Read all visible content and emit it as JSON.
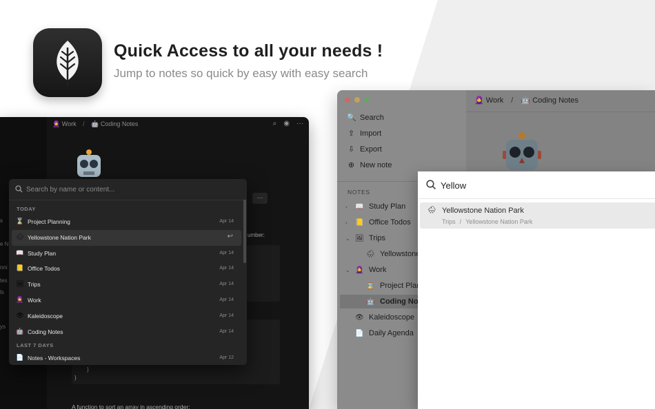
{
  "header": {
    "title": "Quick Access to all your needs !",
    "subtitle": "Jump to notes so quick by easy with easy search"
  },
  "dark_window": {
    "breadcrumb": [
      {
        "icon": "🧕",
        "label": "Work"
      },
      {
        "icon": "🤖",
        "label": "Coding Notes"
      }
    ],
    "fragments": {
      "number_text": "umber:",
      "brace1": "}",
      "brace2": "}",
      "bottom_text": "A function to sort an array in ascending order:",
      "ellipsis": "···"
    },
    "sidebar_edge": [
      "s",
      "e N",
      "nni",
      "tes",
      "ls",
      "ys"
    ],
    "search": {
      "placeholder": "Search by name or content...",
      "sections": [
        {
          "label": "TODAY",
          "items": [
            {
              "icon": "⌛",
              "name": "Project Planning",
              "date": "Apr 14"
            },
            {
              "icon": "🌧",
              "name": "Yellowstone Nation Park",
              "date": "",
              "selected": true
            },
            {
              "icon": "📖",
              "name": "Study Plan",
              "date": "Apr 14"
            },
            {
              "icon": "📒",
              "name": "Office Todos",
              "date": "Apr 14"
            },
            {
              "icon": "🖼",
              "name": "Trips",
              "date": "Apr 14"
            },
            {
              "icon": "🧕",
              "name": "Work",
              "date": "Apr 14"
            },
            {
              "icon": "👁",
              "name": "Kaleidoscope",
              "date": "Apr 14"
            },
            {
              "icon": "🤖",
              "name": "Coding Notes",
              "date": "Apr 14"
            }
          ]
        },
        {
          "label": "LAST 7 DAYS",
          "items": [
            {
              "icon": "📄",
              "name": "Notes - Workspaces",
              "date": "Apr 12"
            }
          ]
        }
      ]
    }
  },
  "light_window": {
    "menu": [
      {
        "icon": "🔍",
        "label": "Search"
      },
      {
        "icon": "⇪",
        "label": "Import"
      },
      {
        "icon": "⇩",
        "label": "Export"
      },
      {
        "icon": "⊕",
        "label": "New note"
      }
    ],
    "notes_label": "NOTES",
    "tree": [
      {
        "chevron": "›",
        "icon": "📖",
        "label": "Study Plan",
        "indent": 0
      },
      {
        "chevron": "›",
        "icon": "📒",
        "label": "Office Todos",
        "indent": 0
      },
      {
        "chevron": "⌄",
        "icon": "🖼",
        "label": "Trips",
        "indent": 0
      },
      {
        "chevron": "",
        "icon": "🌧",
        "label": "Yellowstone N",
        "indent": 1
      },
      {
        "chevron": "⌄",
        "icon": "🧕",
        "label": "Work",
        "indent": 0
      },
      {
        "chevron": "",
        "icon": "⌛",
        "label": "Project Planni",
        "indent": 1
      },
      {
        "chevron": "",
        "icon": "🤖",
        "label": "Coding Notes",
        "indent": 1,
        "selected": true
      },
      {
        "chevron": "",
        "icon": "👁",
        "label": "Kaleidoscope",
        "indent": 0
      },
      {
        "chevron": "",
        "icon": "📄",
        "label": "Daily Agenda",
        "indent": 0
      }
    ],
    "breadcrumb": [
      {
        "icon": "🧕",
        "label": "Work"
      },
      {
        "icon": "🤖",
        "label": "Coding Notes"
      }
    ],
    "search": {
      "query": "Yellow",
      "result": {
        "icon": "🌧",
        "name": "Yellowstone Nation Park",
        "path": [
          "Trips",
          "Yellowstone Nation Park"
        ]
      }
    }
  },
  "colors": {
    "accent_red": "#ff5f57",
    "accent_yellow": "#febc2e",
    "accent_green": "#28c840"
  }
}
